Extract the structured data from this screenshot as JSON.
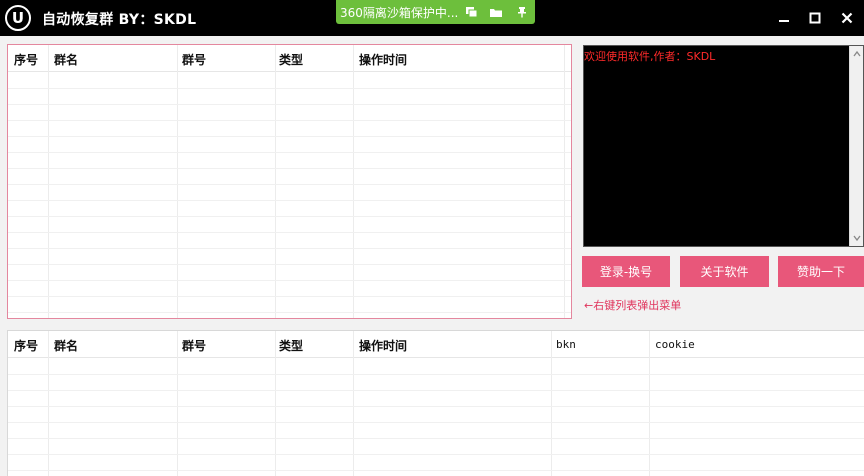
{
  "window": {
    "logo_letter": "U",
    "title": "自动恢复群 BY：SKDL",
    "sandbox_status": "360隔离沙箱保护中..."
  },
  "top_table": {
    "columns": [
      "序号",
      "群名",
      "群号",
      "类型",
      "操作时间"
    ]
  },
  "bottom_table": {
    "columns": [
      "序号",
      "群名",
      "群号",
      "类型",
      "操作时间",
      "bkn",
      "cookie"
    ]
  },
  "console": {
    "log": "欢迎使用软件,作者：SKDL"
  },
  "buttons": {
    "login": "登录-换号",
    "about": "关于软件",
    "donate": "赞助一下"
  },
  "hint": "←右键列表弹出菜单",
  "colors": {
    "titlebar": "#000000",
    "sandbox_green": "#6dbf3c",
    "accent_pink": "#e8577a",
    "console_text": "#ff2a2a"
  }
}
